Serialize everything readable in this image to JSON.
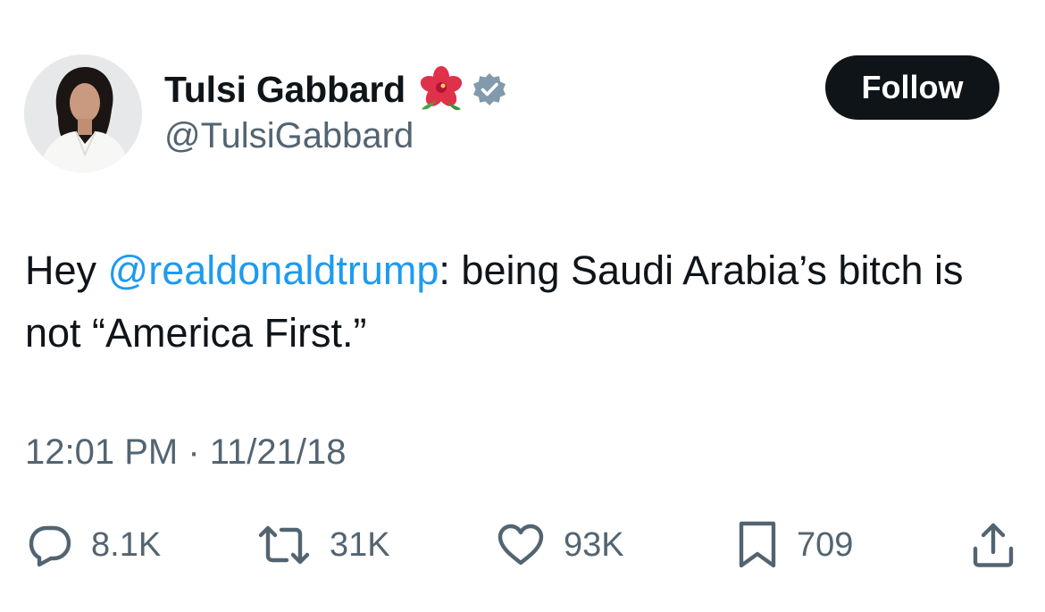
{
  "author": {
    "name": "Tulsi Gabbard",
    "handle": "@TulsiGabbard",
    "flower_icon": "hibiscus-emoji-icon",
    "verified_icon": "verified-badge-icon",
    "verified_color": "#829aab"
  },
  "follow_button": {
    "label": "Follow"
  },
  "tweet": {
    "text_before": "Hey ",
    "mention": "@realdonaldtrump",
    "text_after": ": being Saudi Arabia’s bitch is not “America First.”",
    "timestamp": "12:01 PM · 11/21/18"
  },
  "actions": {
    "reply": {
      "icon": "reply-icon",
      "count": "8.1K"
    },
    "repost": {
      "icon": "repost-icon",
      "count": "31K"
    },
    "like": {
      "icon": "heart-icon",
      "count": "93K"
    },
    "bookmark": {
      "icon": "bookmark-icon",
      "count": "709"
    },
    "share": {
      "icon": "share-icon"
    }
  },
  "colors": {
    "text": "#0f1419",
    "secondary": "#536471",
    "link": "#1d9bf0",
    "button_bg": "#0f1419"
  }
}
